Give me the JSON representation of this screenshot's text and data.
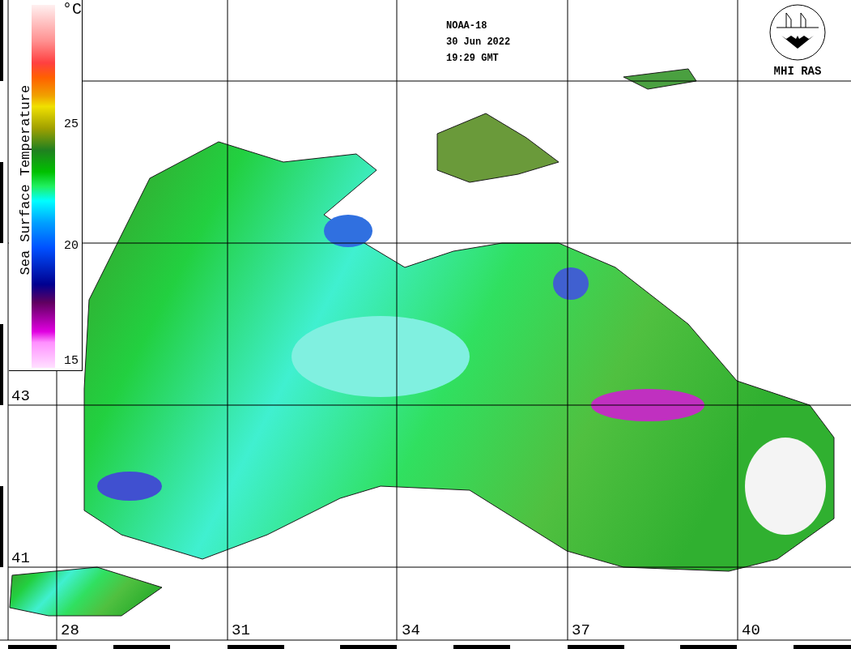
{
  "header": {
    "satellite": "NOAA-18",
    "date": "30 Jun 2022",
    "time": "19:29 GMT"
  },
  "logo": {
    "label": "MHI RAS"
  },
  "legend": {
    "title": "Sea Surface Temperature",
    "unit": "°C",
    "ticks": [
      "25",
      "20",
      "15"
    ]
  },
  "map": {
    "longitudes": [
      "28",
      "31",
      "34",
      "37",
      "40"
    ],
    "latitudes": [
      "43",
      "41"
    ]
  }
}
